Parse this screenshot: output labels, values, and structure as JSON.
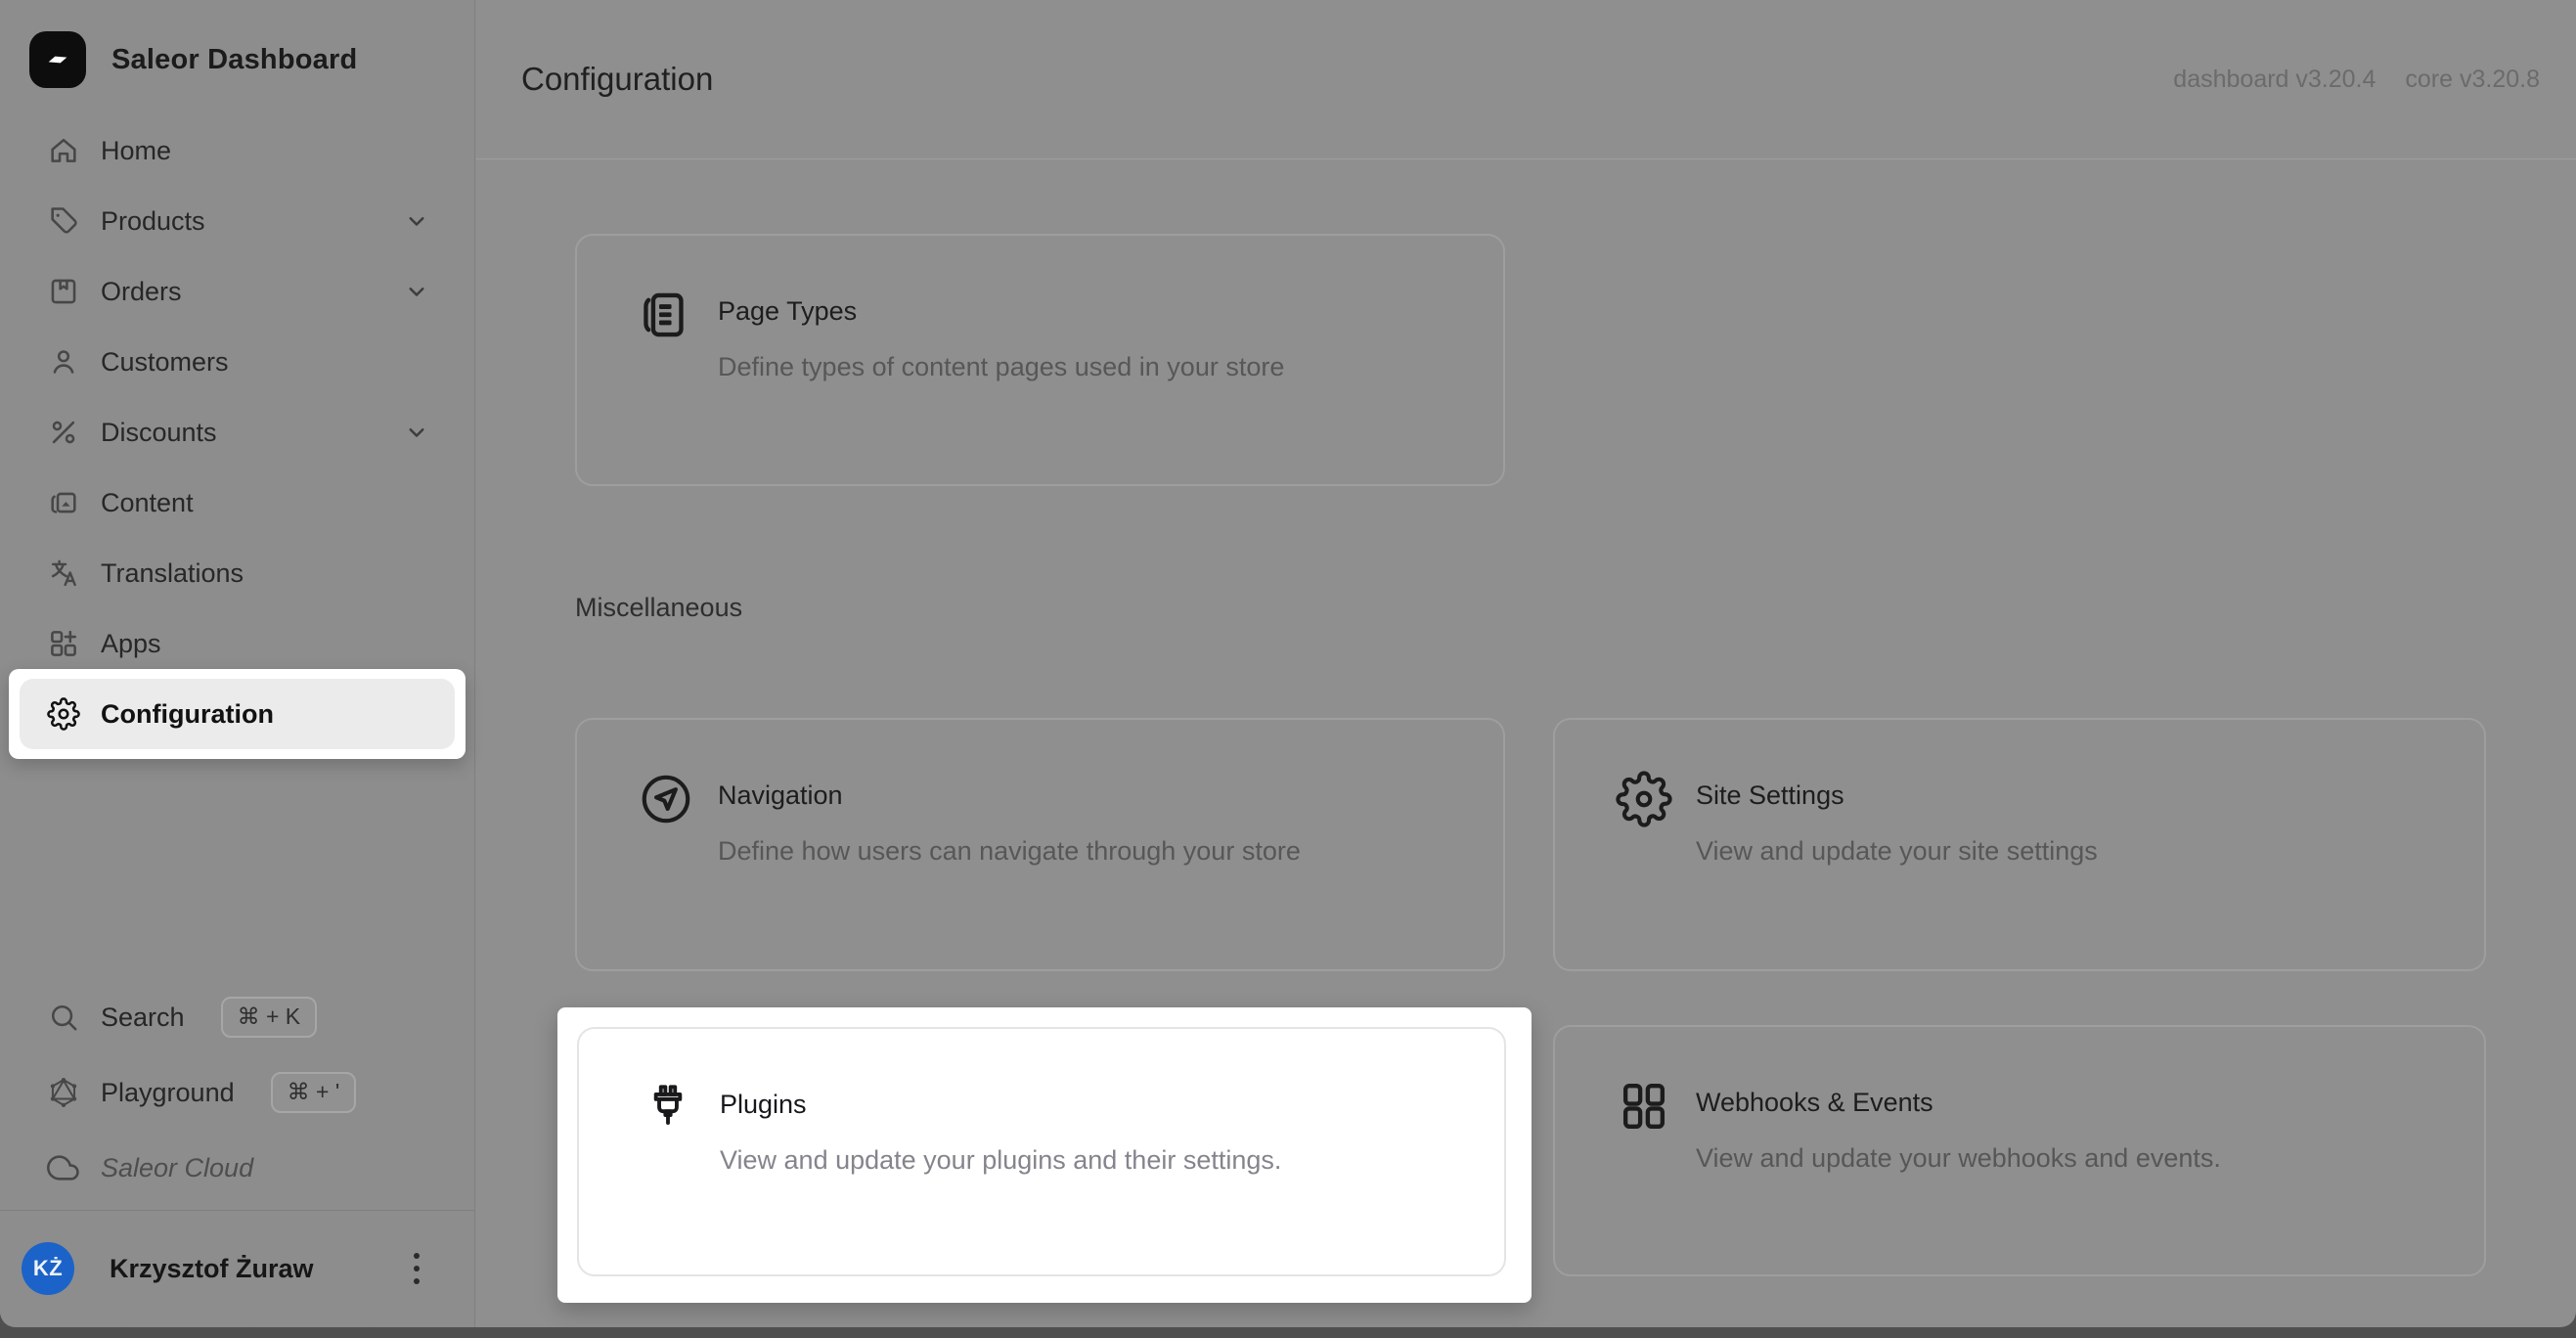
{
  "window": {
    "app_background": "#8f8f8f",
    "sidebar_background": "#8d8d8d",
    "spotlight_color": "#ffffff"
  },
  "sidebar": {
    "brand": {
      "title": "Saleor Dashboard",
      "logo_icon": "saleor-logo",
      "logo_bg": "#0d0d0d"
    },
    "items": [
      {
        "label": "Home",
        "icon": "home-icon",
        "expandable": false
      },
      {
        "label": "Products",
        "icon": "tag-icon",
        "expandable": true
      },
      {
        "label": "Orders",
        "icon": "package-icon",
        "expandable": true
      },
      {
        "label": "Customers",
        "icon": "user-icon",
        "expandable": false
      },
      {
        "label": "Discounts",
        "icon": "percent-icon",
        "expandable": true
      },
      {
        "label": "Content",
        "icon": "content-icon",
        "expandable": false
      },
      {
        "label": "Translations",
        "icon": "translate-icon",
        "expandable": false
      },
      {
        "label": "Apps",
        "icon": "apps-grid-icon",
        "expandable": false
      },
      {
        "label": "Configuration",
        "icon": "gear-icon",
        "expandable": false,
        "active": true,
        "spotlighted": true
      }
    ],
    "footer": [
      {
        "label": "Search",
        "icon": "search-icon",
        "shortcut": "⌘ + K"
      },
      {
        "label": "Playground",
        "icon": "graphql-icon",
        "shortcut": "⌘ + '"
      },
      {
        "label": "Saleor Cloud",
        "icon": "cloud-icon",
        "shortcut": ""
      }
    ],
    "user": {
      "initials": "KŻ",
      "name": "Krzysztof Żuraw",
      "avatar_color": "#1b63c8",
      "menu_icon": "kebab-menu-icon"
    }
  },
  "header": {
    "title": "Configuration",
    "dashboard_version": "dashboard v3.20.4",
    "core_version": "core v3.20.8"
  },
  "content": {
    "section_label": "Miscellaneous",
    "cards": [
      {
        "title": "Page Types",
        "description": "Define types of content pages used in your store",
        "icon": "page-types-icon",
        "highlighted": false
      },
      {
        "title": "Navigation",
        "description": "Define how users can navigate through your store",
        "icon": "navigation-icon",
        "highlighted": false
      },
      {
        "title": "Site Settings",
        "description": "View and update your site settings",
        "icon": "site-settings-icon",
        "highlighted": false
      },
      {
        "title": "Plugins",
        "description": "View and update your plugins and their settings.",
        "icon": "plugins-icon",
        "highlighted": true
      },
      {
        "title": "Webhooks & Events",
        "description": "View and update your webhooks and events.",
        "icon": "webhooks-icon",
        "highlighted": false
      }
    ]
  }
}
